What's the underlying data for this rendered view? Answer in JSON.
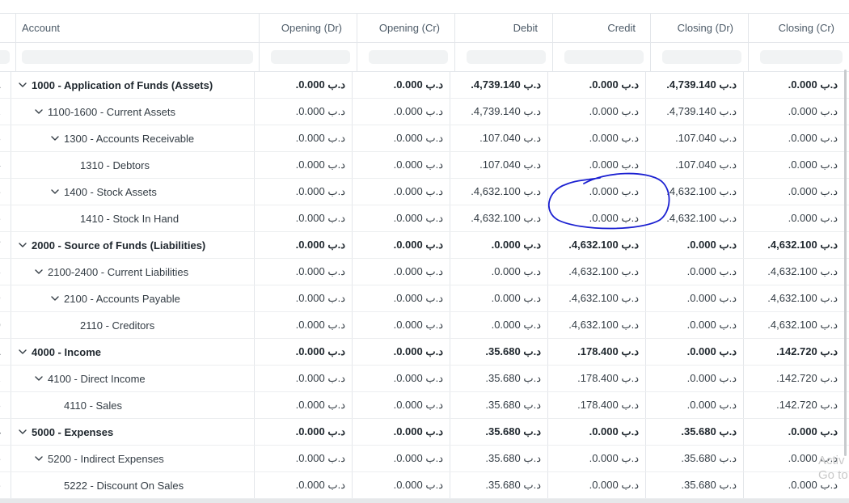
{
  "columns": [
    "Account",
    "Opening (Dr)",
    "Opening (Cr)",
    "Debit",
    "Credit",
    "Closing (Dr)",
    "Closing (Cr)"
  ],
  "rows": [
    {
      "idx": "1",
      "level": 0,
      "expandable": true,
      "bold": true,
      "account": "1000 - Application of Funds (Assets)",
      "opening_dr": ".0.000 د.ب",
      "opening_cr": ".0.000 د.ب",
      "debit": ".4,739.140 د.ب",
      "credit": ".0.000 د.ب",
      "closing_dr": ".4,739.140 د.ب",
      "closing_cr": ".0.000 د.ب"
    },
    {
      "idx": "2",
      "level": 1,
      "expandable": true,
      "bold": false,
      "account": "1100-1600 - Current Assets",
      "opening_dr": ".0.000 د.ب",
      "opening_cr": ".0.000 د.ب",
      "debit": ".4,739.140 د.ب",
      "credit": ".0.000 د.ب",
      "closing_dr": ".4,739.140 د.ب",
      "closing_cr": ".0.000 د.ب"
    },
    {
      "idx": "3",
      "level": 2,
      "expandable": true,
      "bold": false,
      "account": "1300 - Accounts Receivable",
      "opening_dr": ".0.000 د.ب",
      "opening_cr": ".0.000 د.ب",
      "debit": ".107.040 د.ب",
      "credit": ".0.000 د.ب",
      "closing_dr": ".107.040 د.ب",
      "closing_cr": ".0.000 د.ب"
    },
    {
      "idx": "4",
      "level": 3,
      "expandable": false,
      "bold": false,
      "account": "1310 - Debtors",
      "opening_dr": ".0.000 د.ب",
      "opening_cr": ".0.000 د.ب",
      "debit": ".107.040 د.ب",
      "credit": ".0.000 د.ب",
      "closing_dr": ".107.040 د.ب",
      "closing_cr": ".0.000 د.ب"
    },
    {
      "idx": "5",
      "level": 2,
      "expandable": true,
      "bold": false,
      "account": "1400 - Stock Assets",
      "opening_dr": ".0.000 د.ب",
      "opening_cr": ".0.000 د.ب",
      "debit": ".4,632.100 د.ب",
      "credit": ".0.000 د.ب",
      "closing_dr": ".4,632.100 د.ب",
      "closing_cr": ".0.000 د.ب"
    },
    {
      "idx": "6",
      "level": 3,
      "expandable": false,
      "bold": false,
      "account": "1410 - Stock In Hand",
      "opening_dr": ".0.000 د.ب",
      "opening_cr": ".0.000 د.ب",
      "debit": ".4,632.100 د.ب",
      "credit": ".0.000 د.ب",
      "closing_dr": ".4,632.100 د.ب",
      "closing_cr": ".0.000 د.ب"
    },
    {
      "idx": "7",
      "level": 0,
      "expandable": true,
      "bold": true,
      "account": "2000 - Source of Funds (Liabilities)",
      "opening_dr": ".0.000 د.ب",
      "opening_cr": ".0.000 د.ب",
      "debit": ".0.000 د.ب",
      "credit": ".4,632.100 د.ب",
      "closing_dr": ".0.000 د.ب",
      "closing_cr": ".4,632.100 د.ب"
    },
    {
      "idx": "8",
      "level": 1,
      "expandable": true,
      "bold": false,
      "account": "2100-2400 - Current Liabilities",
      "opening_dr": ".0.000 د.ب",
      "opening_cr": ".0.000 د.ب",
      "debit": ".0.000 د.ب",
      "credit": ".4,632.100 د.ب",
      "closing_dr": ".0.000 د.ب",
      "closing_cr": ".4,632.100 د.ب"
    },
    {
      "idx": "9",
      "level": 2,
      "expandable": true,
      "bold": false,
      "account": "2100 - Accounts Payable",
      "opening_dr": ".0.000 د.ب",
      "opening_cr": ".0.000 د.ب",
      "debit": ".0.000 د.ب",
      "credit": ".4,632.100 د.ب",
      "closing_dr": ".0.000 د.ب",
      "closing_cr": ".4,632.100 د.ب"
    },
    {
      "idx": "0",
      "level": 3,
      "expandable": false,
      "bold": false,
      "account": "2110 - Creditors",
      "opening_dr": ".0.000 د.ب",
      "opening_cr": ".0.000 د.ب",
      "debit": ".0.000 د.ب",
      "credit": ".4,632.100 د.ب",
      "closing_dr": ".0.000 د.ب",
      "closing_cr": ".4,632.100 د.ب"
    },
    {
      "idx": "1",
      "level": 0,
      "expandable": true,
      "bold": true,
      "account": "4000 - Income",
      "opening_dr": ".0.000 د.ب",
      "opening_cr": ".0.000 د.ب",
      "debit": ".35.680 د.ب",
      "credit": ".178.400 د.ب",
      "closing_dr": ".0.000 د.ب",
      "closing_cr": ".142.720 د.ب"
    },
    {
      "idx": "2",
      "level": 1,
      "expandable": true,
      "bold": false,
      "account": "4100 - Direct Income",
      "opening_dr": ".0.000 د.ب",
      "opening_cr": ".0.000 د.ب",
      "debit": ".35.680 د.ب",
      "credit": ".178.400 د.ب",
      "closing_dr": ".0.000 د.ب",
      "closing_cr": ".142.720 د.ب"
    },
    {
      "idx": "3",
      "level": 2,
      "expandable": false,
      "bold": false,
      "account": "4110 - Sales",
      "opening_dr": ".0.000 د.ب",
      "opening_cr": ".0.000 د.ب",
      "debit": ".35.680 د.ب",
      "credit": ".178.400 د.ب",
      "closing_dr": ".0.000 د.ب",
      "closing_cr": ".142.720 د.ب"
    },
    {
      "idx": "4",
      "level": 0,
      "expandable": true,
      "bold": true,
      "account": "5000 - Expenses",
      "opening_dr": ".0.000 د.ب",
      "opening_cr": ".0.000 د.ب",
      "debit": ".35.680 د.ب",
      "credit": ".0.000 د.ب",
      "closing_dr": ".35.680 د.ب",
      "closing_cr": ".0.000 د.ب"
    },
    {
      "idx": "5",
      "level": 1,
      "expandable": true,
      "bold": false,
      "account": "5200 - Indirect Expenses",
      "opening_dr": ".0.000 د.ب",
      "opening_cr": ".0.000 د.ب",
      "debit": ".35.680 د.ب",
      "credit": ".0.000 د.ب",
      "closing_dr": ".35.680 د.ب",
      "closing_cr": ".0.000 د.ب"
    },
    {
      "idx": "6",
      "level": 2,
      "expandable": false,
      "bold": false,
      "account": "5222 - Discount On Sales",
      "opening_dr": ".0.000 د.ب",
      "opening_cr": ".0.000 د.ب",
      "debit": ".35.680 د.ب",
      "credit": ".0.000 د.ب",
      "closing_dr": ".35.680 د.ب",
      "closing_cr": ".0.000 د.ب"
    }
  ],
  "watermark": {
    "line1": "Activ",
    "line2": "Go to"
  },
  "icons": {
    "expand": "chevron-down-icon"
  },
  "colors": {
    "annotation": "#1a1fd1",
    "border": "#e3e6ea",
    "filter_bg": "#f1f3f4",
    "text": "#333c44"
  }
}
